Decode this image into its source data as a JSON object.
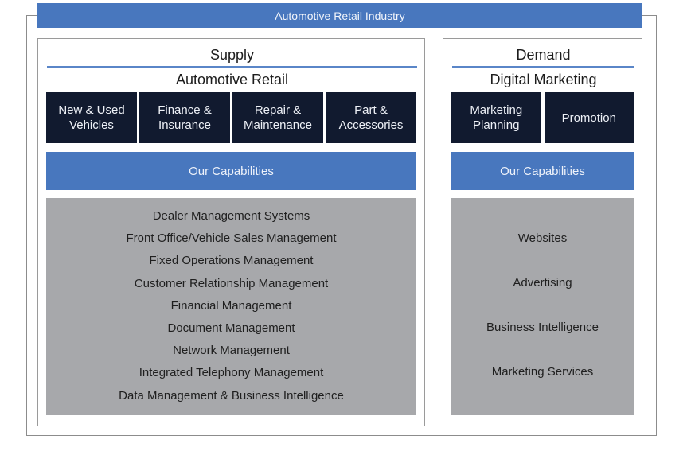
{
  "banner": {
    "title": "Automotive Retail Industry"
  },
  "colors": {
    "banner_blue": "#4877be",
    "tile_navy": "#111a2f",
    "capability_gray": "#a7a8ab",
    "underline_blue": "#5a86c8"
  },
  "supply": {
    "title": "Supply",
    "subtitle": "Automotive Retail",
    "tiles": [
      {
        "label": "New & Used\nVehicles"
      },
      {
        "label": "Finance &\nInsurance"
      },
      {
        "label": "Repair &\nMaintenance"
      },
      {
        "label": "Part &\nAccessories"
      }
    ],
    "capabilities_header": "Our Capabilities",
    "capabilities": [
      "Dealer Management Systems",
      "Front Office/Vehicle Sales Management",
      "Fixed Operations Management",
      "Customer Relationship Management",
      "Financial Management",
      "Document Management",
      "Network Management",
      "Integrated Telephony Management",
      "Data Management & Business Intelligence"
    ]
  },
  "demand": {
    "title": "Demand",
    "subtitle": "Digital Marketing",
    "tiles": [
      {
        "label": "Marketing\nPlanning"
      },
      {
        "label": "Promotion"
      }
    ],
    "capabilities_header": "Our Capabilities",
    "capabilities": [
      "Websites",
      "Advertising",
      "Business Intelligence",
      "Marketing Services"
    ]
  }
}
